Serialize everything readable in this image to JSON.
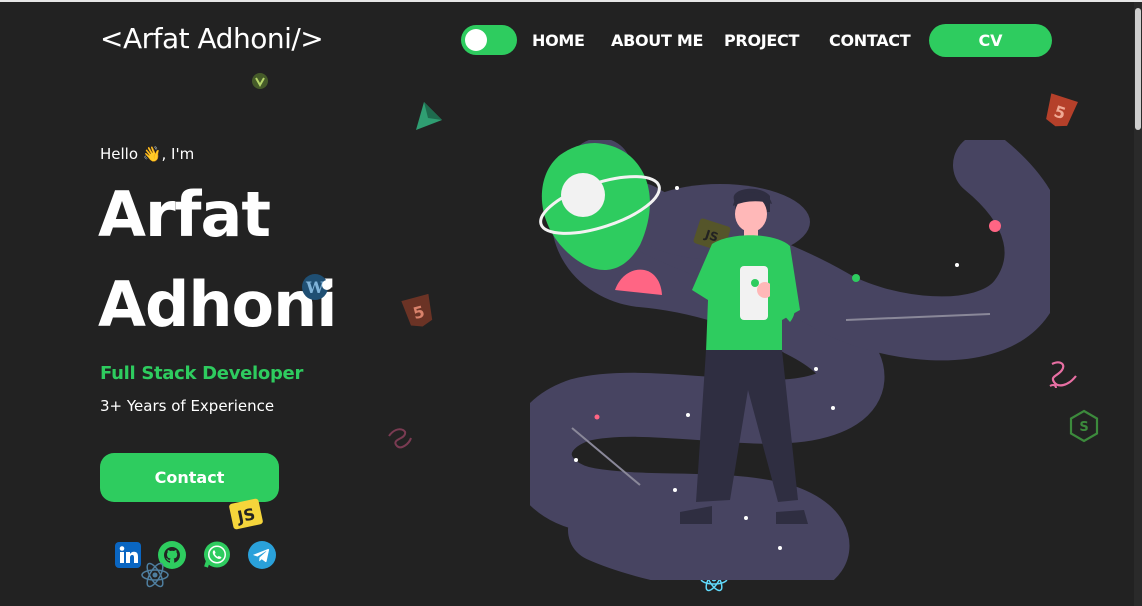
{
  "nav": {
    "logo": "<Arfat Adhoni/>",
    "links": [
      "HOME",
      "ABOUT ME",
      "PROJECT",
      "CONTACT"
    ],
    "cv_label": "CV"
  },
  "hero": {
    "greeting_prefix": "Hello",
    "greeting_emoji": "👋",
    "greeting_suffix": ", I'm",
    "first_name": "Arfat",
    "last_name": "Adhoni",
    "role": "Full Stack Developer",
    "experience": "3+ Years of Experience",
    "contact_label": "Contact"
  },
  "socials": [
    "linkedin-icon",
    "github-icon",
    "whatsapp-icon",
    "telegram-icon"
  ],
  "colors": {
    "accent": "#2ecc5f",
    "background": "#222222",
    "galaxy": "#474461"
  }
}
